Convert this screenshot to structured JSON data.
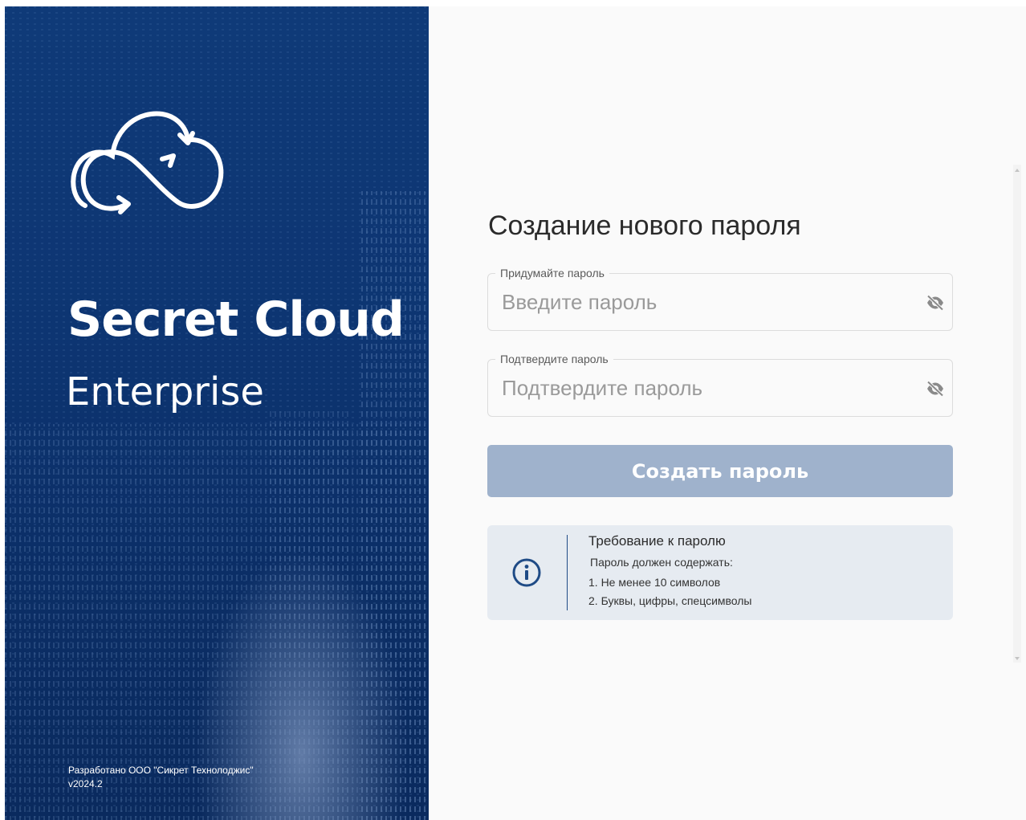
{
  "hero": {
    "brand_title": "Secret Cloud",
    "brand_subtitle": "Enterprise",
    "footer_developer": "Разработано ООО \"Сикрет Технолоджис\"",
    "footer_version": "v2024.2",
    "logo_icon": "cloud-infinity-logo-icon"
  },
  "form": {
    "title": "Создание нового пароля",
    "password": {
      "label": "Придумайте пароль",
      "placeholder": "Введите пароль",
      "value": "",
      "toggle_icon": "eye-off-icon"
    },
    "confirm": {
      "label": "Подтвердите пароль",
      "placeholder": "Подтвердите пароль",
      "value": "",
      "toggle_icon": "eye-off-icon"
    },
    "submit_label": "Создать пароль"
  },
  "requirements": {
    "icon": "info-icon",
    "title": "Требование к паролю",
    "lead": "Пароль должен содержать:",
    "items": [
      "1. Не менее 10 символов",
      "2. Буквы, цифры, спецсимволы"
    ]
  },
  "colors": {
    "hero_blue": "#0d3572",
    "button_disabled": "#9fb2cc",
    "info_background": "#e6ebf1",
    "accent": "#1f4b86"
  }
}
